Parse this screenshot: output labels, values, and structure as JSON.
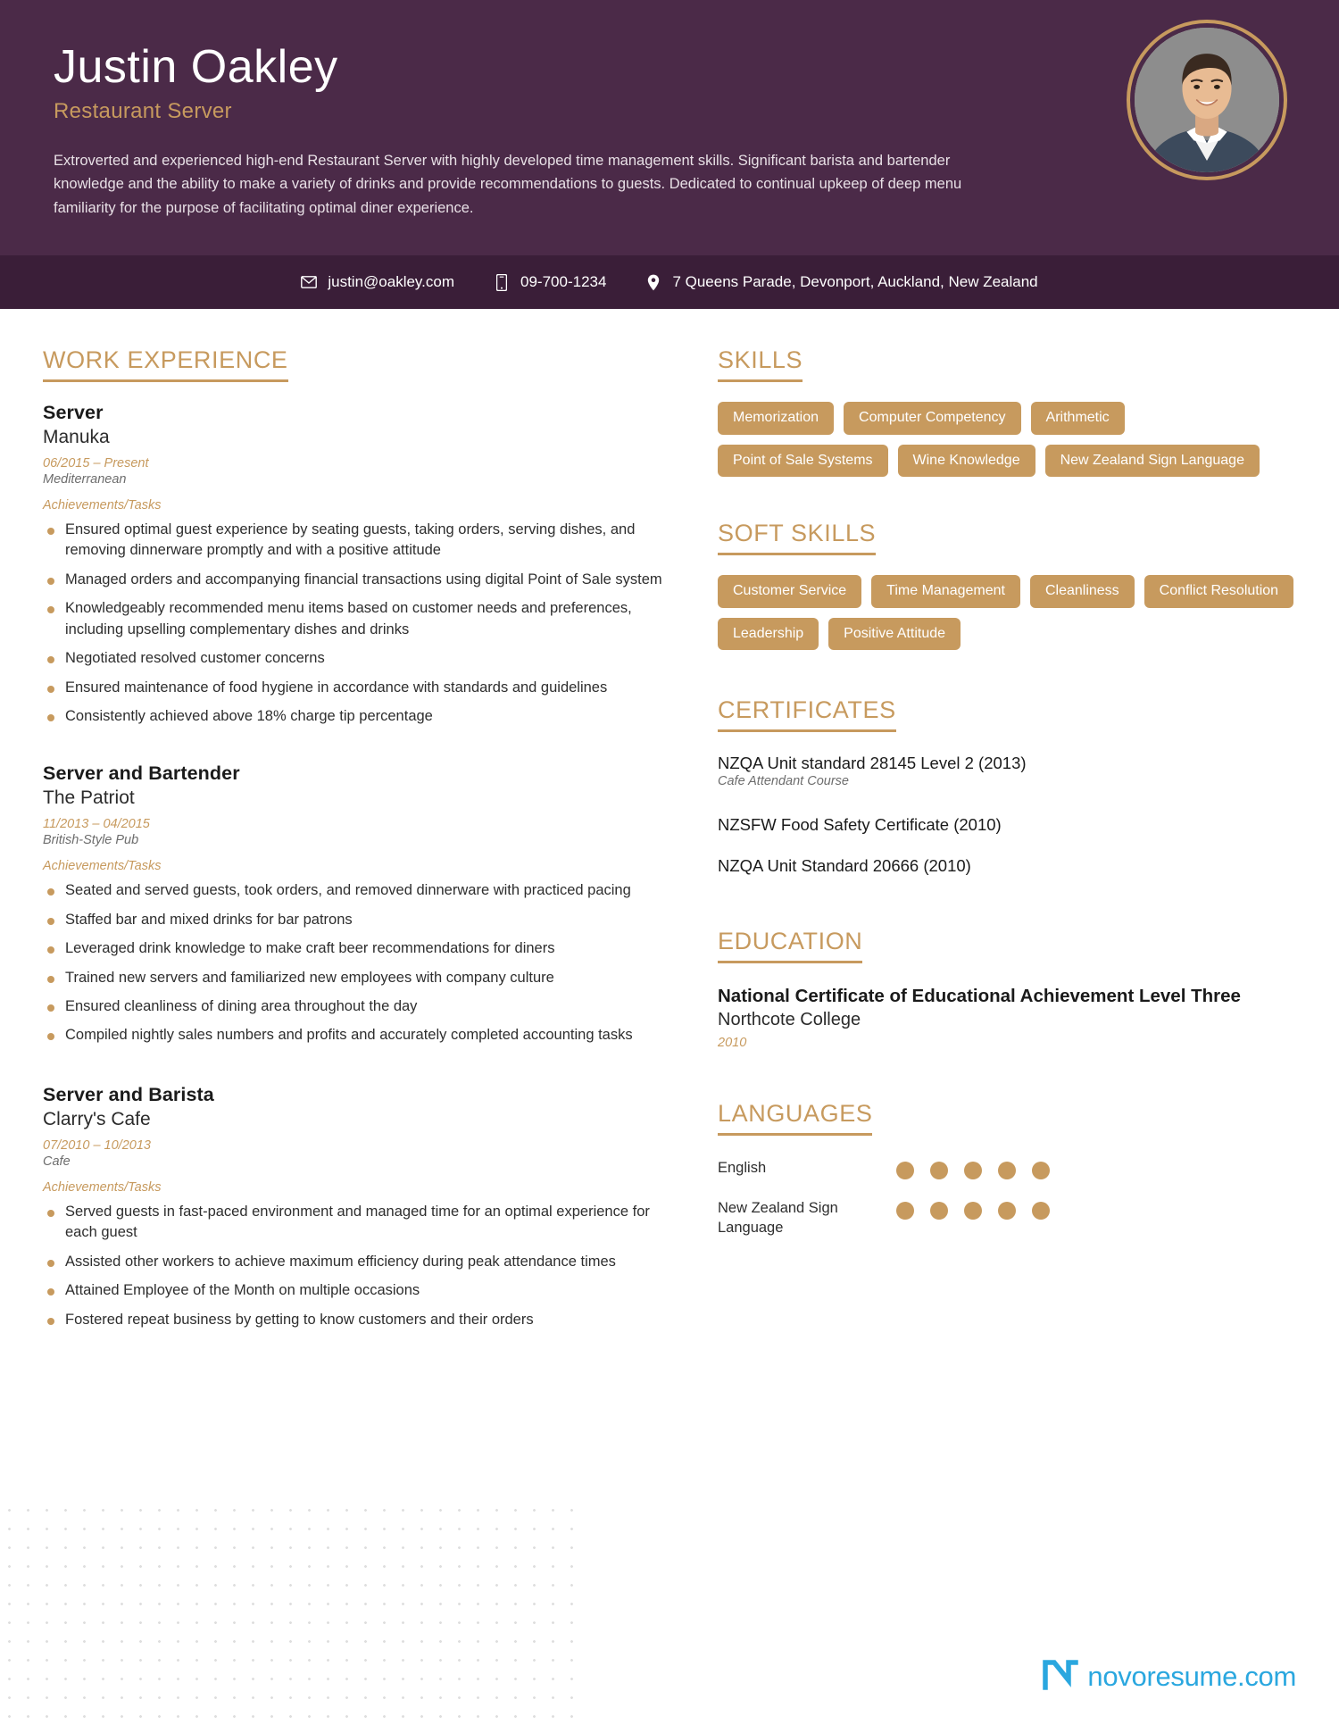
{
  "header": {
    "name": "Justin Oakley",
    "role": "Restaurant Server",
    "summary": "Extroverted and experienced high-end Restaurant Server with highly developed time management skills. Significant barista and bartender knowledge and the ability to make a variety of drinks and provide recommendations to guests. Dedicated to continual upkeep of deep menu familiarity for the purpose of facilitating optimal diner experience.",
    "accent_color": "#c79a5e",
    "background_color": "#4b2a48"
  },
  "contact": {
    "email": "justin@oakley.com",
    "phone": "09-700-1234",
    "address": "7 Queens Parade, Devonport, Auckland, New Zealand",
    "email_icon": "envelope-icon",
    "phone_icon": "mobile-phone-icon",
    "address_icon": "location-pin-icon"
  },
  "work_experience": {
    "title": "WORK EXPERIENCE",
    "achievements_label": "Achievements/Tasks",
    "jobs": [
      {
        "position": "Server",
        "company": "Manuka",
        "dates": "06/2015 – Present",
        "type": "Mediterranean",
        "bullets": [
          "Ensured optimal guest experience by seating guests, taking orders, serving dishes, and removing dinnerware promptly and with a positive attitude",
          "Managed orders and accompanying financial transactions using digital Point of Sale system",
          "Knowledgeably recommended menu items based on customer needs and preferences, including upselling complementary dishes and drinks",
          "Negotiated resolved customer concerns",
          "Ensured maintenance of food hygiene in accordance with standards and guidelines",
          "Consistently achieved above 18% charge tip percentage"
        ]
      },
      {
        "position": "Server and Bartender",
        "company": "The Patriot",
        "dates": "11/2013 – 04/2015",
        "type": "British-Style Pub",
        "bullets": [
          "Seated and served guests, took orders, and removed dinnerware with practiced pacing",
          "Staffed bar and mixed drinks for bar patrons",
          "Leveraged drink knowledge to make craft beer recommendations for diners",
          "Trained new servers and familiarized new employees with company culture",
          "Ensured cleanliness of dining area throughout the day",
          "Compiled nightly sales numbers and profits and accurately completed accounting tasks"
        ]
      },
      {
        "position": "Server and Barista",
        "company": "Clarry's Cafe",
        "dates": "07/2010 – 10/2013",
        "type": "Cafe",
        "bullets": [
          "Served guests in fast-paced environment and managed time for an optimal experience for each guest",
          "Assisted other workers to achieve maximum efficiency during peak attendance times",
          "Attained Employee of the Month on multiple occasions",
          "Fostered repeat business by getting to know customers and their orders"
        ]
      }
    ]
  },
  "skills": {
    "title": "SKILLS",
    "items": [
      "Memorization",
      "Computer Competency",
      "Arithmetic",
      "Point of Sale Systems",
      "Wine Knowledge",
      "New Zealand Sign Language"
    ]
  },
  "soft_skills": {
    "title": "SOFT SKILLS",
    "items": [
      "Customer Service",
      "Time Management",
      "Cleanliness",
      "Conflict Resolution",
      "Leadership",
      "Positive Attitude"
    ]
  },
  "certificates": {
    "title": "CERTIFICATES",
    "items": [
      {
        "name": "NZQA Unit standard 28145 Level 2 (2013)",
        "sub": "Cafe Attendant Course"
      },
      {
        "name": "NZSFW Food Safety Certificate (2010)",
        "sub": ""
      },
      {
        "name": "NZQA Unit Standard 20666 (2010)",
        "sub": ""
      }
    ]
  },
  "education": {
    "title": "EDUCATION",
    "items": [
      {
        "degree": "National Certificate of Educational Achievement Level Three",
        "school": "Northcote College",
        "year": "2010"
      }
    ]
  },
  "languages": {
    "title": "LANGUAGES",
    "max_level": 5,
    "items": [
      {
        "name": "English",
        "level": 5
      },
      {
        "name": "New Zealand Sign Language",
        "level": 5
      }
    ]
  },
  "footer": {
    "brand": "novoresume.com",
    "brand_color": "#2aa7df"
  }
}
